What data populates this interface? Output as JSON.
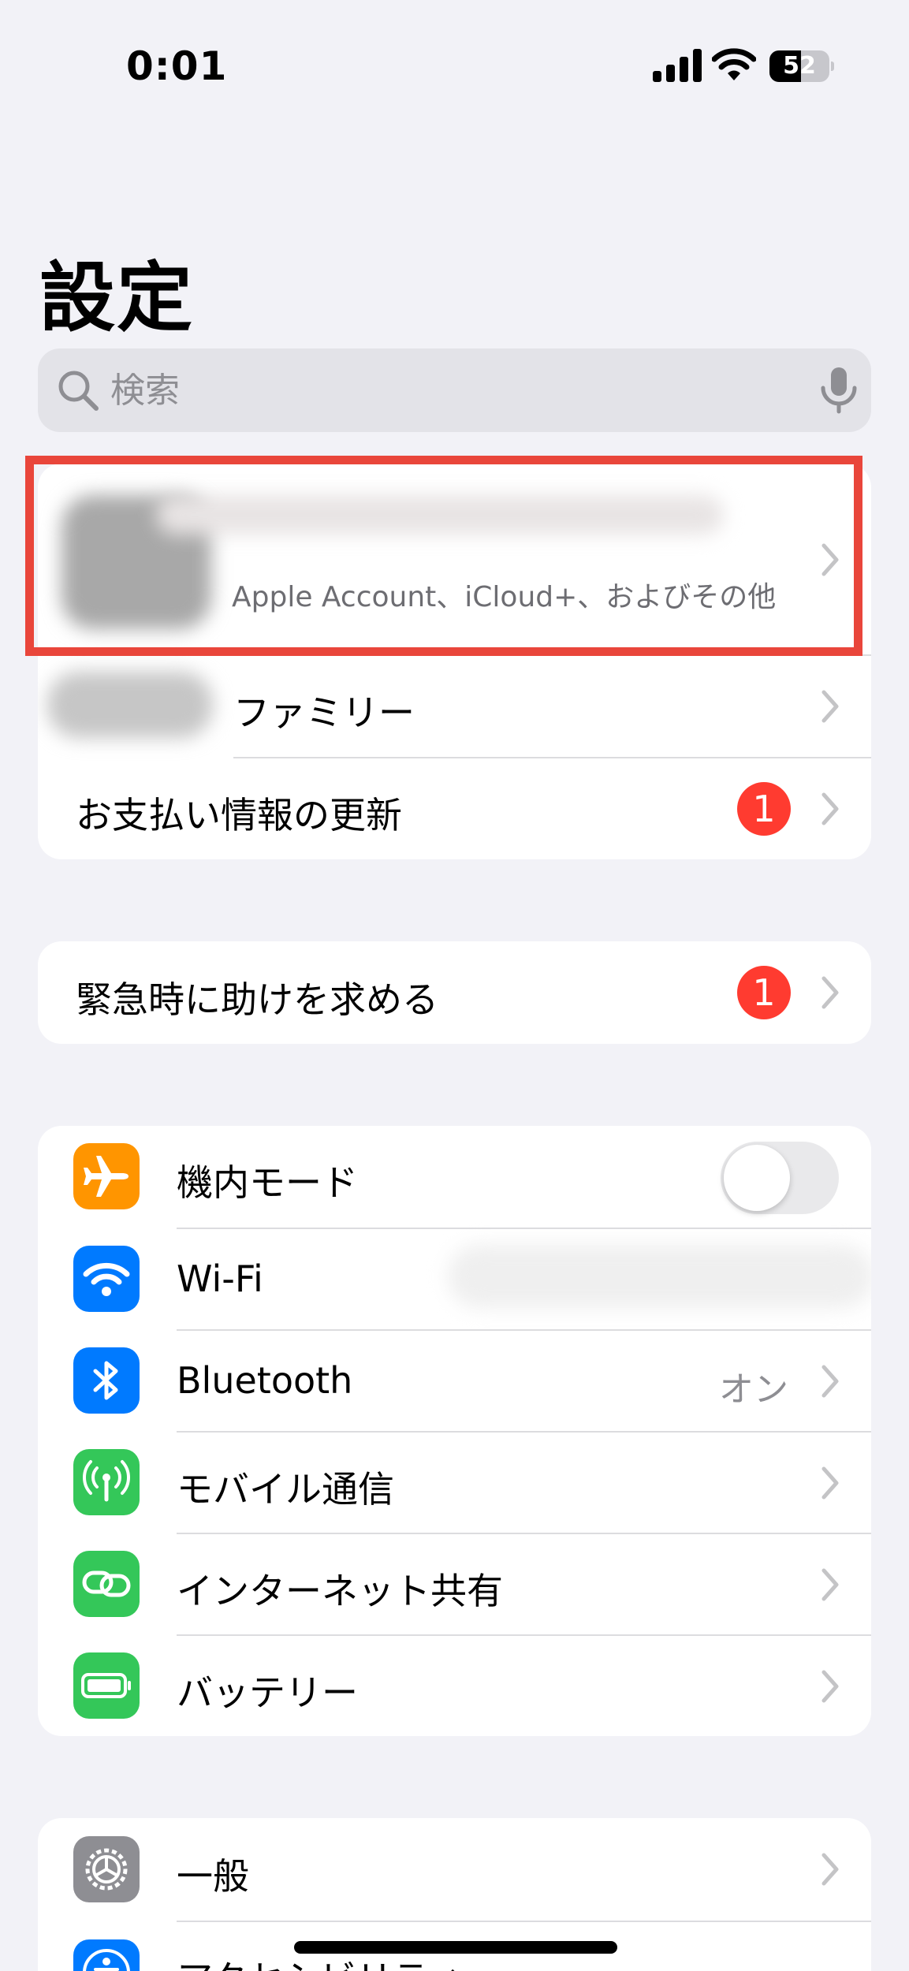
{
  "status_bar": {
    "time": "0:01",
    "battery": "52"
  },
  "title": "設定",
  "search": {
    "placeholder": "検索"
  },
  "account_group": {
    "subtitle": "Apple Account、iCloud+、およびその他",
    "family_label": "ファミリー",
    "payment_label": "お支払い情報の更新",
    "payment_badge": "1"
  },
  "emergency_group": {
    "label": "緊急時に助けを求める",
    "badge": "1"
  },
  "connectivity_group": {
    "items": [
      {
        "label": "機内モード",
        "icon": "airplane-icon",
        "color": "#ff9500"
      },
      {
        "label": "Wi-Fi",
        "icon": "wifi-icon",
        "color": "#007aff"
      },
      {
        "label": "Bluetooth",
        "icon": "bluetooth-icon",
        "color": "#007aff",
        "value": "オン"
      },
      {
        "label": "モバイル通信",
        "icon": "antenna-icon",
        "color": "#34c759"
      },
      {
        "label": "インターネット共有",
        "icon": "link-icon",
        "color": "#34c759"
      },
      {
        "label": "バッテリー",
        "icon": "battery-icon",
        "color": "#34c759"
      }
    ]
  },
  "general_group": {
    "items": [
      {
        "label": "一般",
        "icon": "gear-icon",
        "color": "#8e8e93"
      },
      {
        "label": "アクセシビリティ",
        "icon": "accessibility-icon",
        "color": "#007aff"
      }
    ]
  },
  "colors": {
    "accent": "#007aff",
    "badge": "#ff3b30",
    "highlight": "#e9463b",
    "background": "#f2f2f7"
  }
}
